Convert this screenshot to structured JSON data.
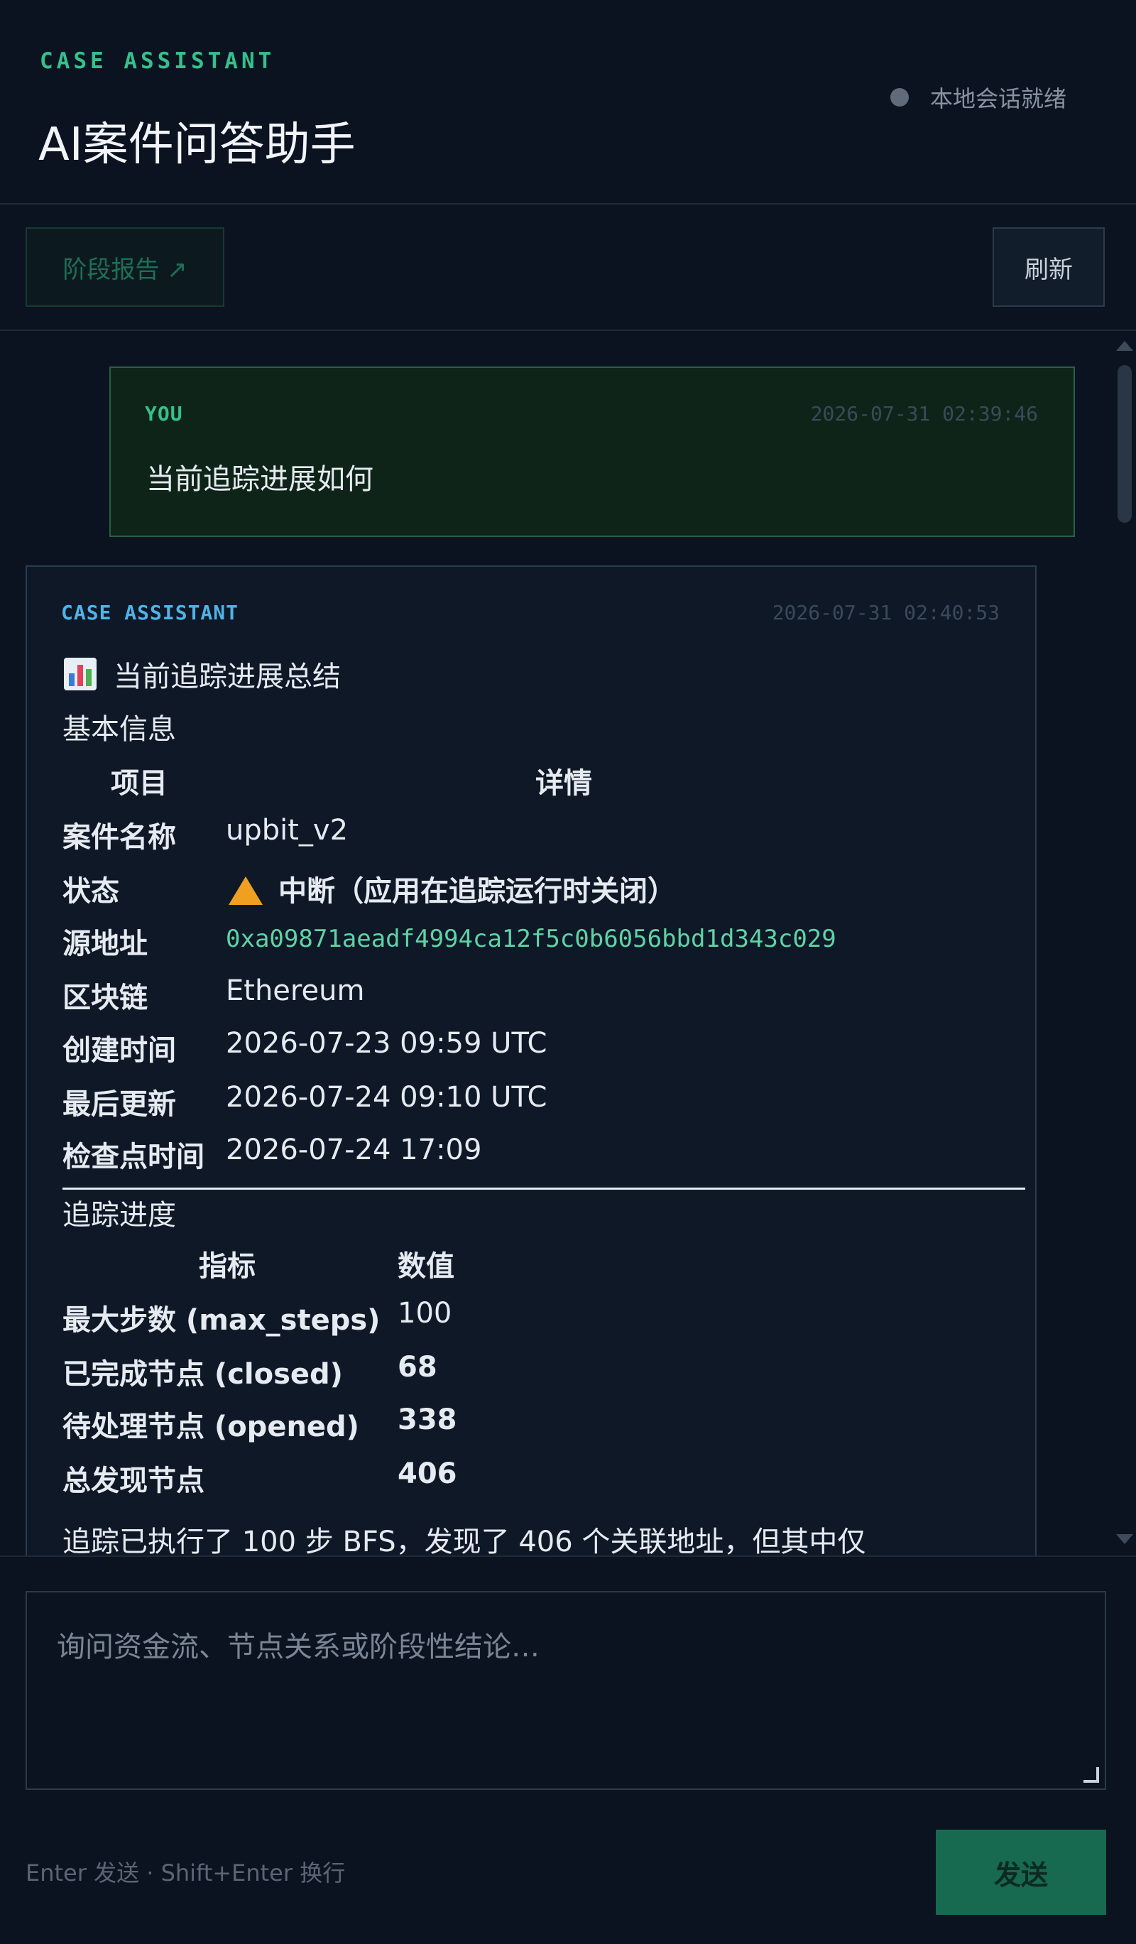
{
  "header": {
    "eyebrow": "CASE ASSISTANT",
    "title": "AI案件问答助手",
    "status": "本地会话就绪"
  },
  "toolbar": {
    "report_label": "阶段报告 ↗",
    "refresh_label": "刷新"
  },
  "messages": {
    "user": {
      "role": "YOU",
      "time": "2026-07-31 02:39:46",
      "text": "当前追踪进展如何"
    },
    "assistant": {
      "role": "CASE ASSISTANT",
      "time": "2026-07-31 02:40:53",
      "summary_title": "当前追踪进展总结",
      "basic_section": "基本信息",
      "basic_headers": [
        "项目",
        "详情"
      ],
      "basic_rows": [
        {
          "key": "案件名称",
          "value": "upbit_v2"
        },
        {
          "key": "状态",
          "value": "中断（应用在追踪运行时关闭）"
        },
        {
          "key": "源地址",
          "value": "0xa09871aeadf4994ca12f5c0b6056bbd1d343c029"
        },
        {
          "key": "区块链",
          "value": "Ethereum"
        },
        {
          "key": "创建时间",
          "value": "2026-07-23 09:59 UTC"
        },
        {
          "key": "最后更新",
          "value": "2026-07-24 09:10 UTC"
        },
        {
          "key": "检查点时间",
          "value": "2026-07-24 17:09"
        }
      ],
      "progress_section": "追踪进度",
      "progress_headers": [
        "指标",
        "数值"
      ],
      "progress_rows": [
        {
          "key": "最大步数 (max_steps)",
          "value": "100"
        },
        {
          "key": "已完成节点 (closed)",
          "value": "68"
        },
        {
          "key": "待处理节点 (opened)",
          "value": "338"
        },
        {
          "key": "总发现节点",
          "value": "406"
        }
      ],
      "paragraph_cut": "追踪已执行了 100 步 BFS，发现了 406 个关联地址，但其中仅"
    }
  },
  "composer": {
    "placeholder": "询问资金流、节点关系或阶段性结论…",
    "hint": "Enter 发送 · Shift+Enter 换行",
    "send_label": "发送"
  },
  "icons": {
    "status": "status-dot-icon",
    "summary": "bar-chart-icon",
    "warning": "warning-icon"
  }
}
